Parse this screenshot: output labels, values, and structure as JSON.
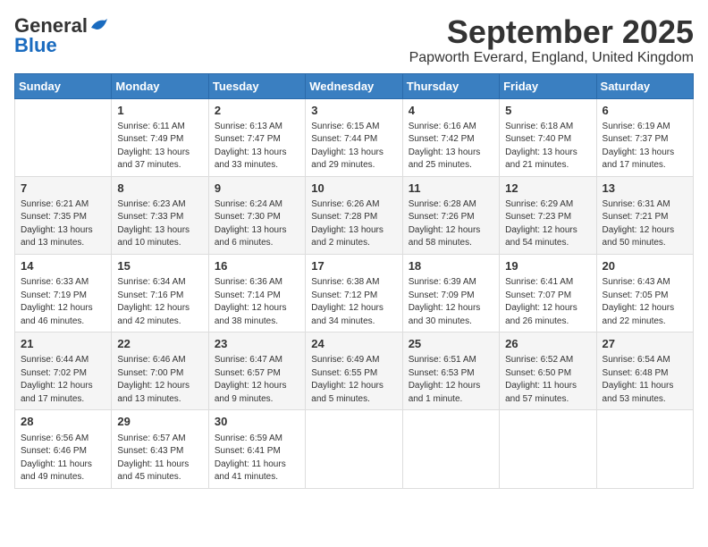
{
  "header": {
    "logo_general": "General",
    "logo_blue": "Blue",
    "month": "September 2025",
    "location": "Papworth Everard, England, United Kingdom"
  },
  "weekdays": [
    "Sunday",
    "Monday",
    "Tuesday",
    "Wednesday",
    "Thursday",
    "Friday",
    "Saturday"
  ],
  "weeks": [
    [
      {
        "day": "",
        "sunrise": "",
        "sunset": "",
        "daylight": ""
      },
      {
        "day": "1",
        "sunrise": "Sunrise: 6:11 AM",
        "sunset": "Sunset: 7:49 PM",
        "daylight": "Daylight: 13 hours and 37 minutes."
      },
      {
        "day": "2",
        "sunrise": "Sunrise: 6:13 AM",
        "sunset": "Sunset: 7:47 PM",
        "daylight": "Daylight: 13 hours and 33 minutes."
      },
      {
        "day": "3",
        "sunrise": "Sunrise: 6:15 AM",
        "sunset": "Sunset: 7:44 PM",
        "daylight": "Daylight: 13 hours and 29 minutes."
      },
      {
        "day": "4",
        "sunrise": "Sunrise: 6:16 AM",
        "sunset": "Sunset: 7:42 PM",
        "daylight": "Daylight: 13 hours and 25 minutes."
      },
      {
        "day": "5",
        "sunrise": "Sunrise: 6:18 AM",
        "sunset": "Sunset: 7:40 PM",
        "daylight": "Daylight: 13 hours and 21 minutes."
      },
      {
        "day": "6",
        "sunrise": "Sunrise: 6:19 AM",
        "sunset": "Sunset: 7:37 PM",
        "daylight": "Daylight: 13 hours and 17 minutes."
      }
    ],
    [
      {
        "day": "7",
        "sunrise": "Sunrise: 6:21 AM",
        "sunset": "Sunset: 7:35 PM",
        "daylight": "Daylight: 13 hours and 13 minutes."
      },
      {
        "day": "8",
        "sunrise": "Sunrise: 6:23 AM",
        "sunset": "Sunset: 7:33 PM",
        "daylight": "Daylight: 13 hours and 10 minutes."
      },
      {
        "day": "9",
        "sunrise": "Sunrise: 6:24 AM",
        "sunset": "Sunset: 7:30 PM",
        "daylight": "Daylight: 13 hours and 6 minutes."
      },
      {
        "day": "10",
        "sunrise": "Sunrise: 6:26 AM",
        "sunset": "Sunset: 7:28 PM",
        "daylight": "Daylight: 13 hours and 2 minutes."
      },
      {
        "day": "11",
        "sunrise": "Sunrise: 6:28 AM",
        "sunset": "Sunset: 7:26 PM",
        "daylight": "Daylight: 12 hours and 58 minutes."
      },
      {
        "day": "12",
        "sunrise": "Sunrise: 6:29 AM",
        "sunset": "Sunset: 7:23 PM",
        "daylight": "Daylight: 12 hours and 54 minutes."
      },
      {
        "day": "13",
        "sunrise": "Sunrise: 6:31 AM",
        "sunset": "Sunset: 7:21 PM",
        "daylight": "Daylight: 12 hours and 50 minutes."
      }
    ],
    [
      {
        "day": "14",
        "sunrise": "Sunrise: 6:33 AM",
        "sunset": "Sunset: 7:19 PM",
        "daylight": "Daylight: 12 hours and 46 minutes."
      },
      {
        "day": "15",
        "sunrise": "Sunrise: 6:34 AM",
        "sunset": "Sunset: 7:16 PM",
        "daylight": "Daylight: 12 hours and 42 minutes."
      },
      {
        "day": "16",
        "sunrise": "Sunrise: 6:36 AM",
        "sunset": "Sunset: 7:14 PM",
        "daylight": "Daylight: 12 hours and 38 minutes."
      },
      {
        "day": "17",
        "sunrise": "Sunrise: 6:38 AM",
        "sunset": "Sunset: 7:12 PM",
        "daylight": "Daylight: 12 hours and 34 minutes."
      },
      {
        "day": "18",
        "sunrise": "Sunrise: 6:39 AM",
        "sunset": "Sunset: 7:09 PM",
        "daylight": "Daylight: 12 hours and 30 minutes."
      },
      {
        "day": "19",
        "sunrise": "Sunrise: 6:41 AM",
        "sunset": "Sunset: 7:07 PM",
        "daylight": "Daylight: 12 hours and 26 minutes."
      },
      {
        "day": "20",
        "sunrise": "Sunrise: 6:43 AM",
        "sunset": "Sunset: 7:05 PM",
        "daylight": "Daylight: 12 hours and 22 minutes."
      }
    ],
    [
      {
        "day": "21",
        "sunrise": "Sunrise: 6:44 AM",
        "sunset": "Sunset: 7:02 PM",
        "daylight": "Daylight: 12 hours and 17 minutes."
      },
      {
        "day": "22",
        "sunrise": "Sunrise: 6:46 AM",
        "sunset": "Sunset: 7:00 PM",
        "daylight": "Daylight: 12 hours and 13 minutes."
      },
      {
        "day": "23",
        "sunrise": "Sunrise: 6:47 AM",
        "sunset": "Sunset: 6:57 PM",
        "daylight": "Daylight: 12 hours and 9 minutes."
      },
      {
        "day": "24",
        "sunrise": "Sunrise: 6:49 AM",
        "sunset": "Sunset: 6:55 PM",
        "daylight": "Daylight: 12 hours and 5 minutes."
      },
      {
        "day": "25",
        "sunrise": "Sunrise: 6:51 AM",
        "sunset": "Sunset: 6:53 PM",
        "daylight": "Daylight: 12 hours and 1 minute."
      },
      {
        "day": "26",
        "sunrise": "Sunrise: 6:52 AM",
        "sunset": "Sunset: 6:50 PM",
        "daylight": "Daylight: 11 hours and 57 minutes."
      },
      {
        "day": "27",
        "sunrise": "Sunrise: 6:54 AM",
        "sunset": "Sunset: 6:48 PM",
        "daylight": "Daylight: 11 hours and 53 minutes."
      }
    ],
    [
      {
        "day": "28",
        "sunrise": "Sunrise: 6:56 AM",
        "sunset": "Sunset: 6:46 PM",
        "daylight": "Daylight: 11 hours and 49 minutes."
      },
      {
        "day": "29",
        "sunrise": "Sunrise: 6:57 AM",
        "sunset": "Sunset: 6:43 PM",
        "daylight": "Daylight: 11 hours and 45 minutes."
      },
      {
        "day": "30",
        "sunrise": "Sunrise: 6:59 AM",
        "sunset": "Sunset: 6:41 PM",
        "daylight": "Daylight: 11 hours and 41 minutes."
      },
      {
        "day": "",
        "sunrise": "",
        "sunset": "",
        "daylight": ""
      },
      {
        "day": "",
        "sunrise": "",
        "sunset": "",
        "daylight": ""
      },
      {
        "day": "",
        "sunrise": "",
        "sunset": "",
        "daylight": ""
      },
      {
        "day": "",
        "sunrise": "",
        "sunset": "",
        "daylight": ""
      }
    ]
  ]
}
